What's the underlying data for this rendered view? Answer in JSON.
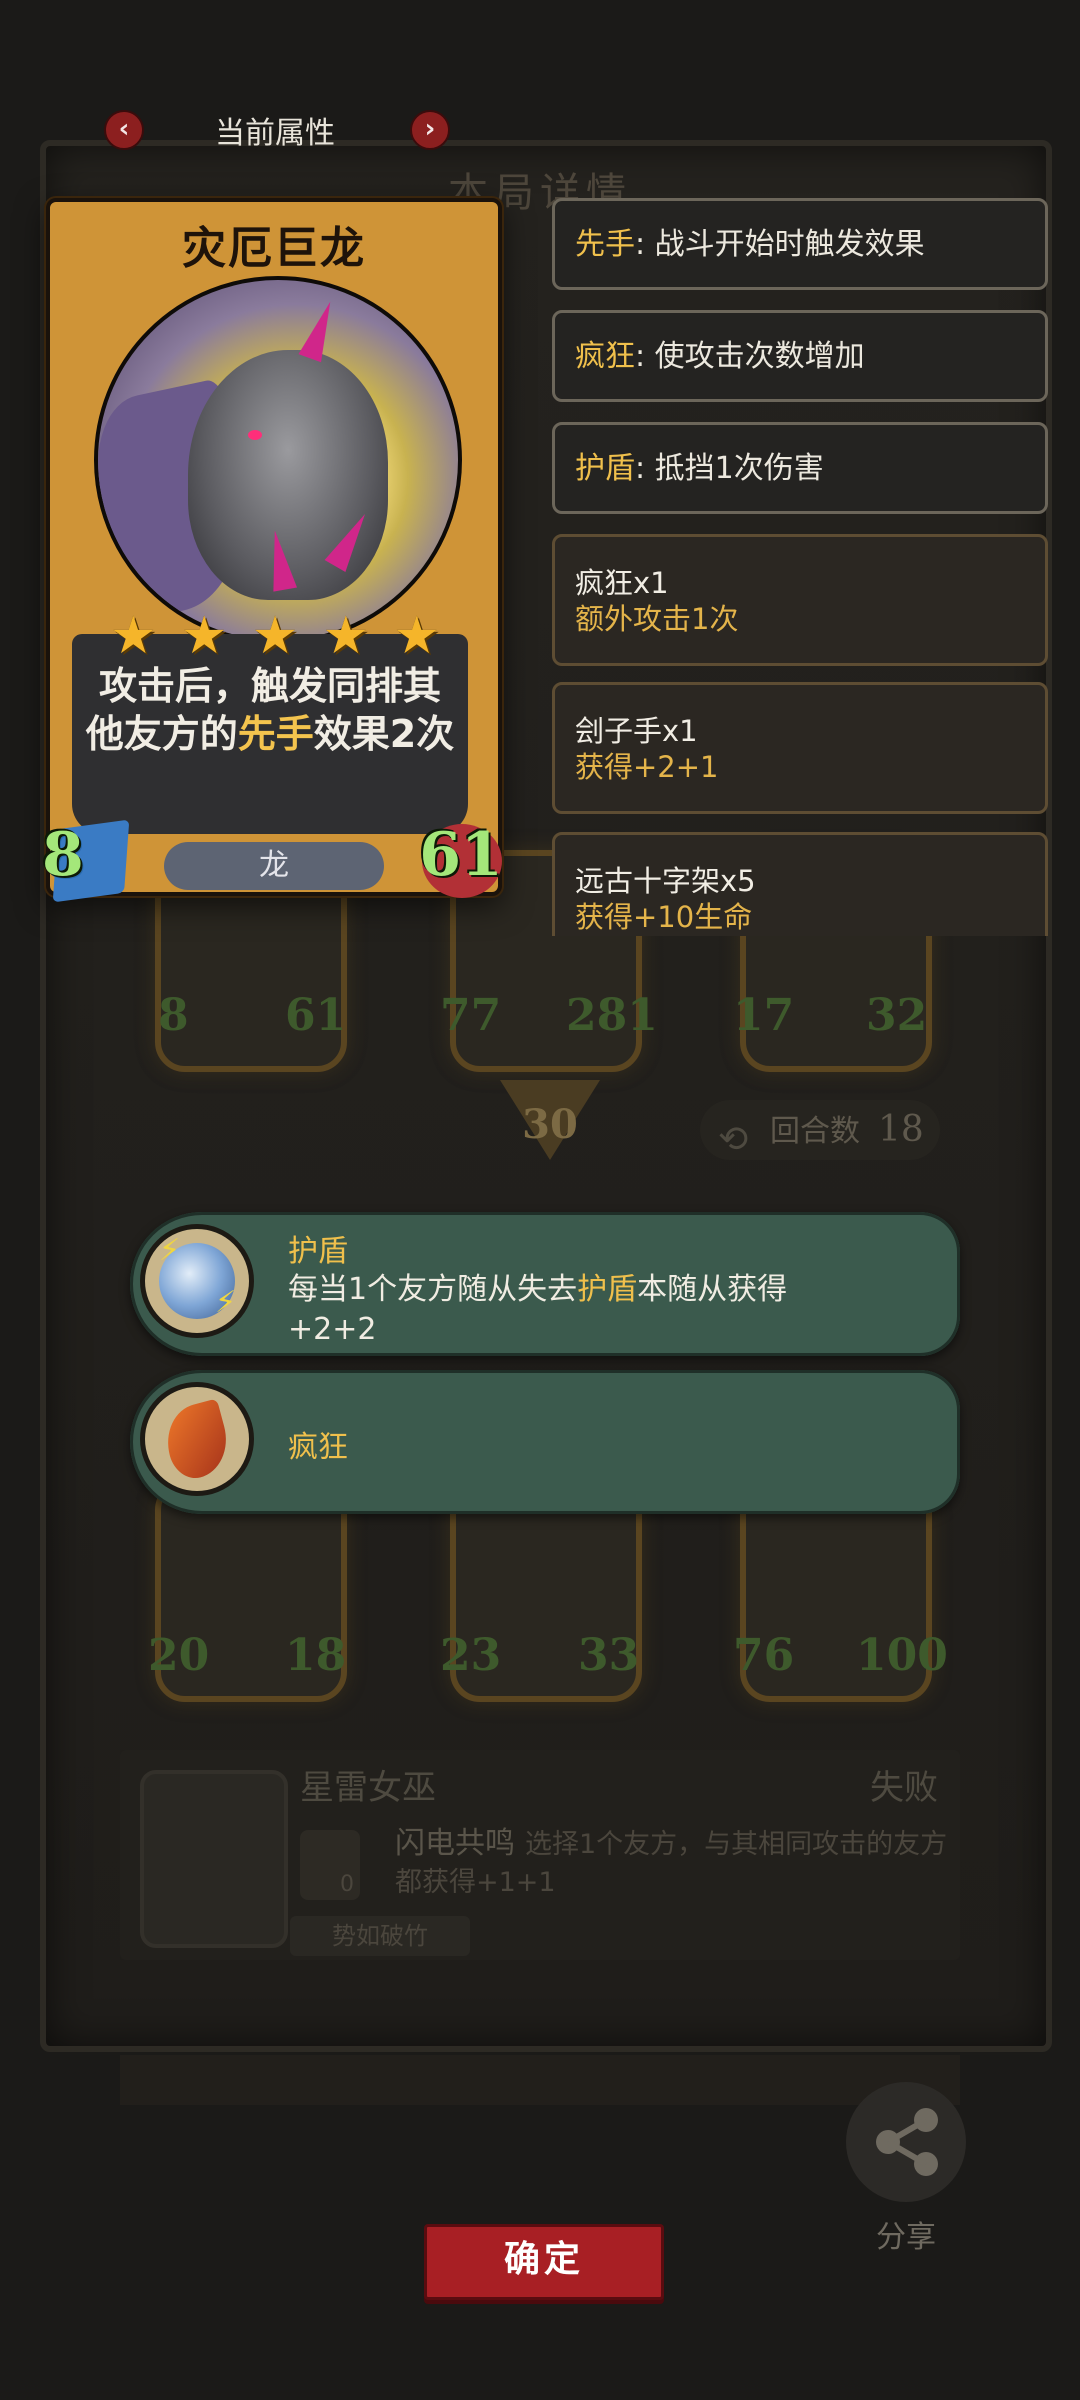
{
  "header": {
    "title": "当前属性",
    "prev_icon": "chevron-left-icon",
    "next_icon": "chevron-right-icon"
  },
  "background": {
    "panel_title": "本局详情",
    "units_row1": [
      {
        "atk": "8",
        "hp": "61"
      },
      {
        "atk": "77",
        "hp": "281"
      },
      {
        "atk": "17",
        "hp": "32"
      }
    ],
    "round_badge": "30",
    "rounds_label": "回合数",
    "rounds_value": "18",
    "units_row2": [
      {
        "atk": "20",
        "hp": "18"
      },
      {
        "atk": "23",
        "hp": "33"
      },
      {
        "atk": "76",
        "hp": "100"
      }
    ],
    "opponent": {
      "name": "星雷女巫",
      "result": "失败",
      "skill_name": "闪电共鸣",
      "skill_desc": "选择1个友方，与其相同攻击的友方都获得+1+1",
      "skill_cost": "0",
      "tag": "势如破竹"
    }
  },
  "card": {
    "name": "灾厄巨龙",
    "stars": 5,
    "desc_line1": "攻击后，触发同排其",
    "desc_line2_pre": "他友方的",
    "desc_line2_hl": "先手",
    "desc_line2_post": "效果2次",
    "race": "龙",
    "attack": "8",
    "health": "61"
  },
  "keywords": [
    {
      "key": "先手",
      "sep": ": ",
      "text": "战斗开始时触发效果"
    },
    {
      "key": "疯狂",
      "sep": ": ",
      "text": "使攻击次数增加"
    },
    {
      "key": "护盾",
      "sep": ": ",
      "text": "抵挡1次伤害"
    }
  ],
  "effects": [
    {
      "title": "疯狂x1",
      "detail": "额外攻击1次"
    },
    {
      "title": "刽子手x1",
      "detail": "获得+2+1"
    },
    {
      "title": "远古十字架x5",
      "detail": "获得+10生命"
    }
  ],
  "banners": {
    "shield": {
      "title": "护盾",
      "desc_pre": "每当1个友方随从失去",
      "desc_key": "护盾",
      "desc_post": "本随从获得+2+2"
    },
    "rage": {
      "title": "疯狂"
    }
  },
  "actions": {
    "confirm_label": "确定",
    "share_label": "分享"
  },
  "colors": {
    "keyword_highlight": "#f0c04c",
    "confirm_red": "#a81f24",
    "banner_green": "#3b5a4d",
    "card_gold": "#cf9437"
  }
}
